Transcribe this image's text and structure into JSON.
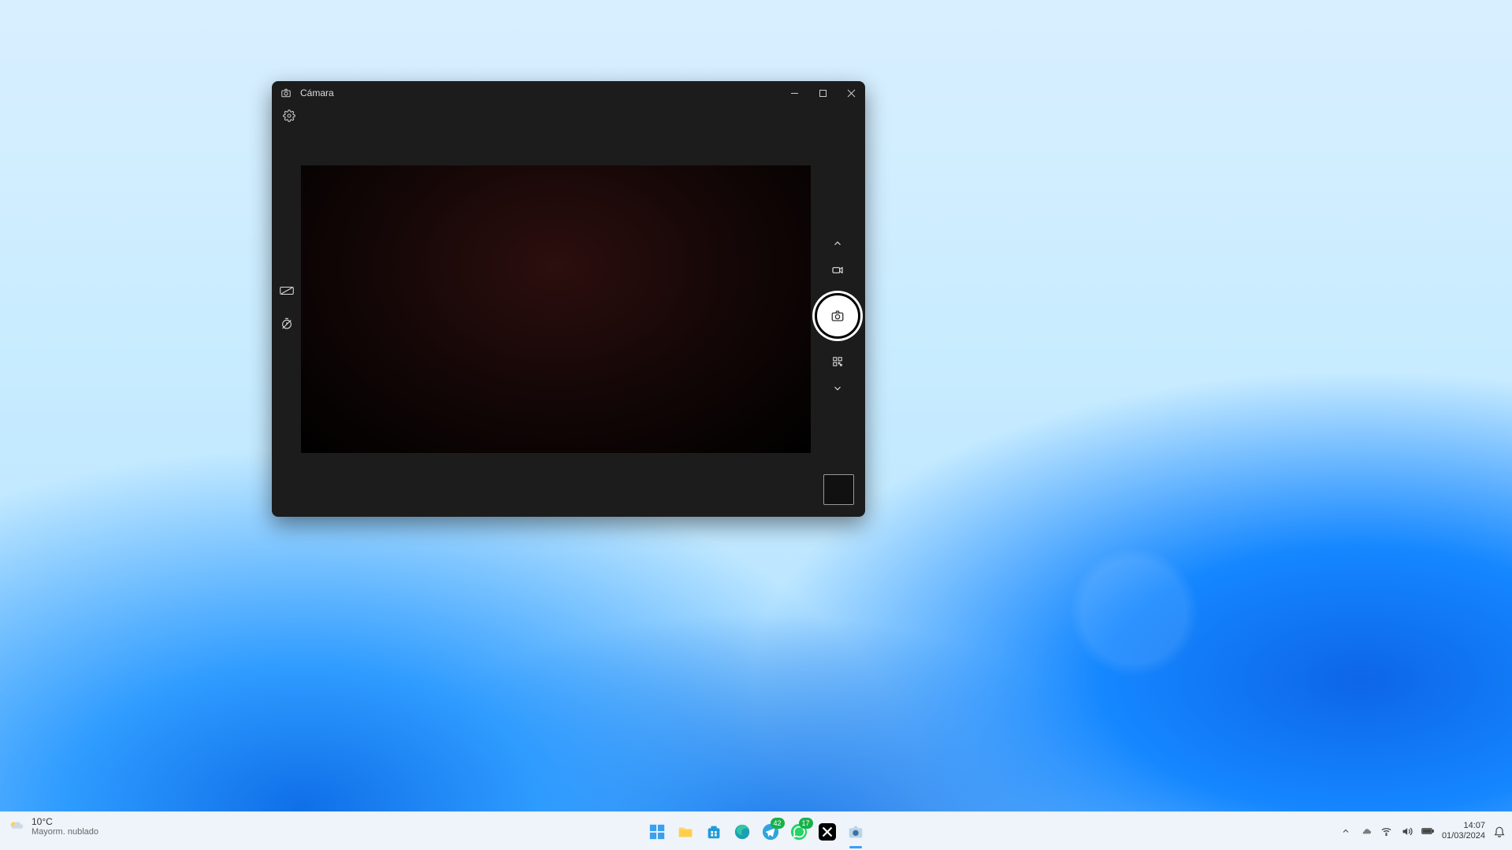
{
  "window": {
    "title": "Cámara",
    "icons": {
      "app": "camera-icon",
      "minimize": "minimize-icon",
      "maximize": "maximize-icon",
      "close": "close-icon",
      "settings": "gear-icon"
    },
    "left_tools": {
      "hdr": "hdr-off-icon",
      "timer": "timer-off-icon"
    },
    "right_tools": {
      "up": "chevron-up-icon",
      "video": "video-mode-icon",
      "shutter": "camera-icon",
      "qr": "qr-scan-icon",
      "down": "chevron-down-icon"
    },
    "gallery": "gallery-thumb"
  },
  "taskbar": {
    "weather": {
      "temp": "10°C",
      "condition": "Mayorm. nublado"
    },
    "apps": {
      "start": "start-icon",
      "explorer": "file-explorer-icon",
      "store": "microsoft-store-icon",
      "edge": "edge-icon",
      "telegram": "telegram-icon",
      "telegram_badge": "42",
      "whatsapp": "whatsapp-icon",
      "whatsapp_badge": "17",
      "x": "x-twitter-icon",
      "camera": "camera-icon"
    },
    "tray": {
      "chevron": "chevron-up-icon",
      "onedrive": "cloud-icon",
      "wifi": "wifi-icon",
      "volume": "volume-icon",
      "battery": "battery-icon",
      "time": "14:07",
      "date": "01/03/2024",
      "notifications": "notification-bell-icon"
    }
  }
}
